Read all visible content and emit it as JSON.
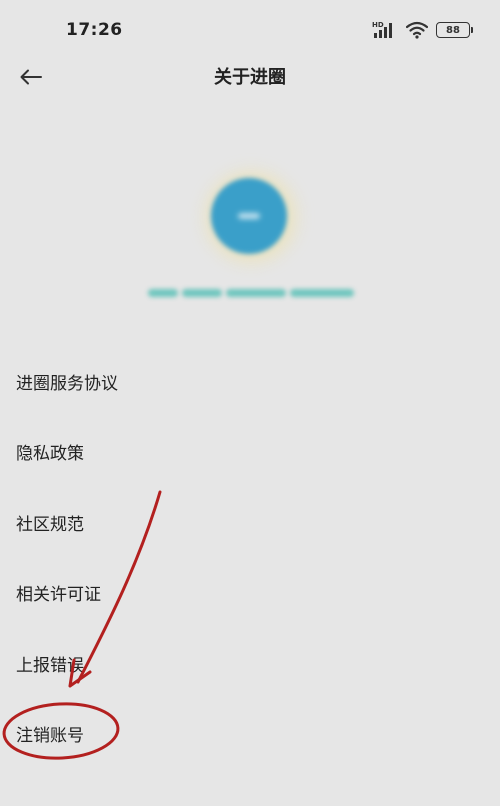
{
  "status_bar": {
    "time": "17:26",
    "network_label": "HD",
    "battery": "88"
  },
  "nav": {
    "title": "关于进圈"
  },
  "menu": {
    "items": [
      {
        "label": "进圈服务协议"
      },
      {
        "label": "隐私政策"
      },
      {
        "label": "社区规范"
      },
      {
        "label": "相关许可证"
      },
      {
        "label": "上报错误"
      },
      {
        "label": "注销账号"
      }
    ]
  },
  "colors": {
    "background": "#e6e6e6",
    "logo": "#3a9fc9",
    "annotation": "#b3201f"
  }
}
